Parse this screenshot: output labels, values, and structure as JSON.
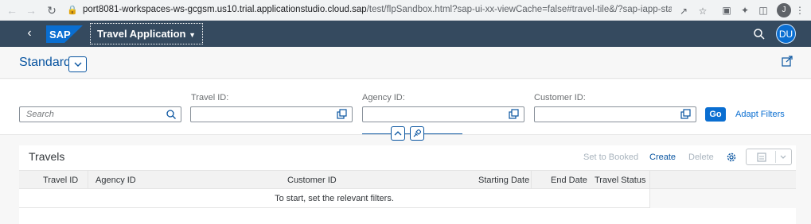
{
  "browser": {
    "url_host": "port8081-workspaces-ws-gcgsm.us10.trial.applicationstudio.cloud.sap",
    "url_path": "/test/flpSandbox.html?sap-ui-xx-viewCache=false#travel-tile&/?sap-iapp-state--history...",
    "profile_initial": "J"
  },
  "shell": {
    "app_title": "Travel Application",
    "avatar_initials": "DU",
    "logo_text": "SAP",
    "logo_color": "#0a6ed1",
    "bar_color": "#354a5f"
  },
  "header": {
    "variant_name": "Standard"
  },
  "filters": {
    "search_placeholder": "Search",
    "travel_id_label": "Travel ID:",
    "agency_id_label": "Agency ID:",
    "customer_id_label": "Customer ID:",
    "go_label": "Go",
    "adapt_label": "Adapt Filters"
  },
  "table": {
    "title": "Travels",
    "toolbar": {
      "set_booked": "Set to Booked",
      "create": "Create",
      "delete": "Delete"
    },
    "columns": [
      "Travel ID",
      "Agency ID",
      "Customer ID",
      "Starting Date",
      "End Date",
      "Travel Status"
    ],
    "no_data_text": "To start, set the relevant filters."
  }
}
